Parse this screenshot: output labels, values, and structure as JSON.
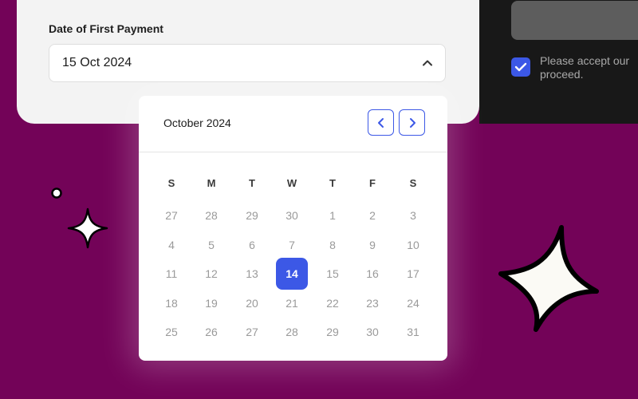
{
  "form": {
    "field_label": "Date of First Payment",
    "selected_date": "15 Oct 2024"
  },
  "consent": {
    "checked": true,
    "text": "Please accept our proceed."
  },
  "calendar": {
    "month_label": "October 2024",
    "weekdays": [
      "S",
      "M",
      "T",
      "W",
      "T",
      "F",
      "S"
    ],
    "weeks": [
      [
        "27",
        "28",
        "29",
        "30",
        "1",
        "2",
        "3"
      ],
      [
        "4",
        "5",
        "6",
        "7",
        "8",
        "9",
        "10"
      ],
      [
        "11",
        "12",
        "13",
        "14",
        "15",
        "16",
        "17"
      ],
      [
        "18",
        "19",
        "20",
        "21",
        "22",
        "23",
        "24"
      ],
      [
        "25",
        "26",
        "27",
        "28",
        "29",
        "30",
        "31"
      ]
    ],
    "selected_day": "14"
  },
  "colors": {
    "background": "#730358",
    "accent": "#3c58e6",
    "dark_panel": "#181818"
  },
  "icons": [
    "chevron-up-icon",
    "chevron-left-icon",
    "chevron-right-icon",
    "checkmark-icon",
    "sparkle-icon",
    "dot-icon"
  ]
}
